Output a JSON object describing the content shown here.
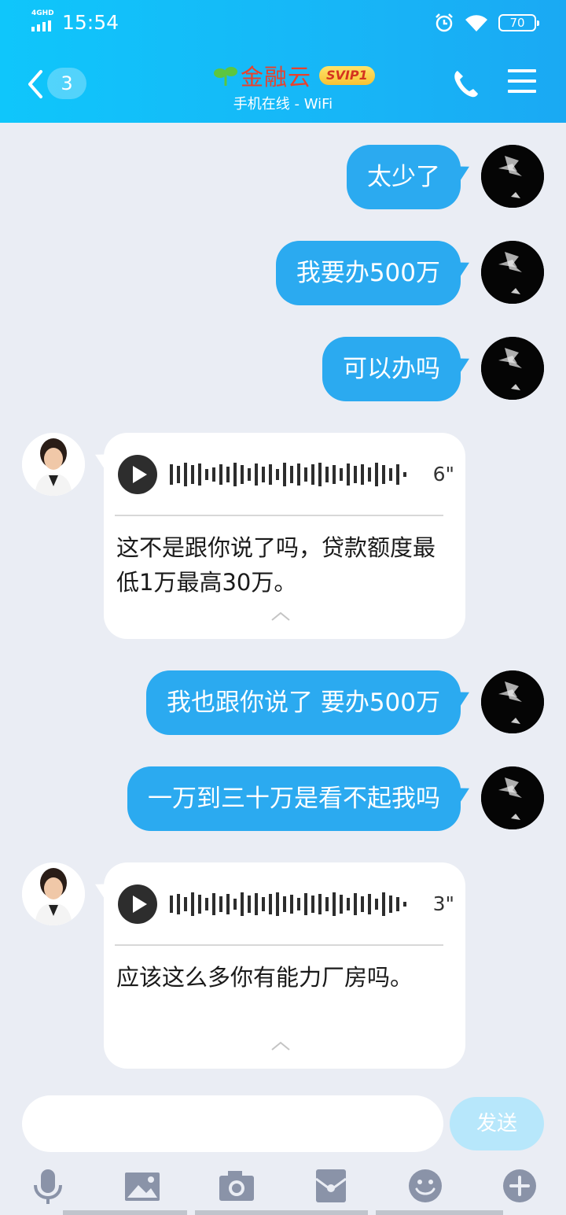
{
  "status_bar": {
    "network": "4GHD",
    "time": "15:54",
    "battery": "70"
  },
  "header": {
    "back_count": "3",
    "title": "金融云",
    "badge": "SVIP1",
    "subtitle": "手机在线 - WiFi"
  },
  "messages": [
    {
      "side": "out",
      "text": "太少了"
    },
    {
      "side": "out",
      "text": "我要办500万"
    },
    {
      "side": "out",
      "text": "可以办吗"
    },
    {
      "side": "in",
      "voice_duration": "6\"",
      "transcript": "这不是跟你说了吗，贷款额度最低1万最高30万。"
    },
    {
      "side": "out",
      "text": "我也跟你说了  要办500万"
    },
    {
      "side": "out",
      "text": "一万到三十万是看不起我吗"
    },
    {
      "side": "in",
      "voice_duration": "3\"",
      "transcript": "应该这么多你有能力厂房吗。"
    }
  ],
  "composer": {
    "input_value": "",
    "send_label": "发送"
  },
  "toolbar": {
    "items": [
      "mic-icon",
      "image-icon",
      "camera-icon",
      "red-packet-icon",
      "emoji-icon",
      "plus-icon"
    ]
  },
  "colors": {
    "header": "#17b6f7",
    "outgoing_bubble": "#2baaf0",
    "title": "#e9412c",
    "background": "#eaedf4"
  }
}
